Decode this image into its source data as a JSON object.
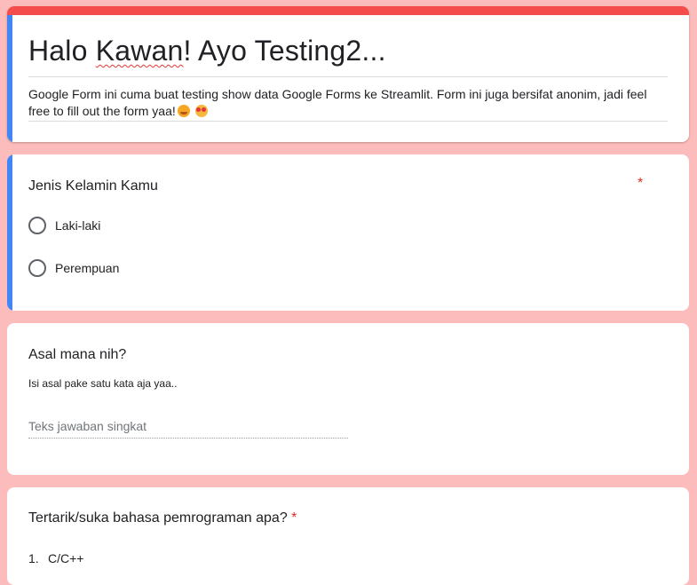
{
  "colors": {
    "background": "#fdbcbc",
    "theme_bar": "#f44b4b",
    "active_accent": "#4285f4",
    "required": "#d93025"
  },
  "form": {
    "title_prefix": "Halo ",
    "title_flagged_word": "Kawan",
    "title_suffix": "! Ayo Testing2...",
    "description": "Google Form ini cuma buat testing show data Google Forms ke Streamlit. Form ini juga bersifat anonim, jadi feel free to fill out the form yaa!",
    "description_emoji_icons": [
      "smiling-face-with-open-hands-icon",
      "star-struck-icon"
    ]
  },
  "questions": [
    {
      "title": "Jenis Kelamin Kamu",
      "required_mark": "*",
      "type": "radio",
      "options": [
        "Laki-laki",
        "Perempuan"
      ]
    },
    {
      "title": "Asal mana nih?",
      "help_text": "Isi asal pake satu kata aja yaa..",
      "type": "short_answer",
      "placeholder": "Teks jawaban singkat"
    },
    {
      "title": "Tertarik/suka bahasa pemrograman apa?",
      "required_mark": "*",
      "type": "list",
      "items": [
        {
          "number": "1.",
          "label": "C/C++"
        }
      ]
    }
  ]
}
